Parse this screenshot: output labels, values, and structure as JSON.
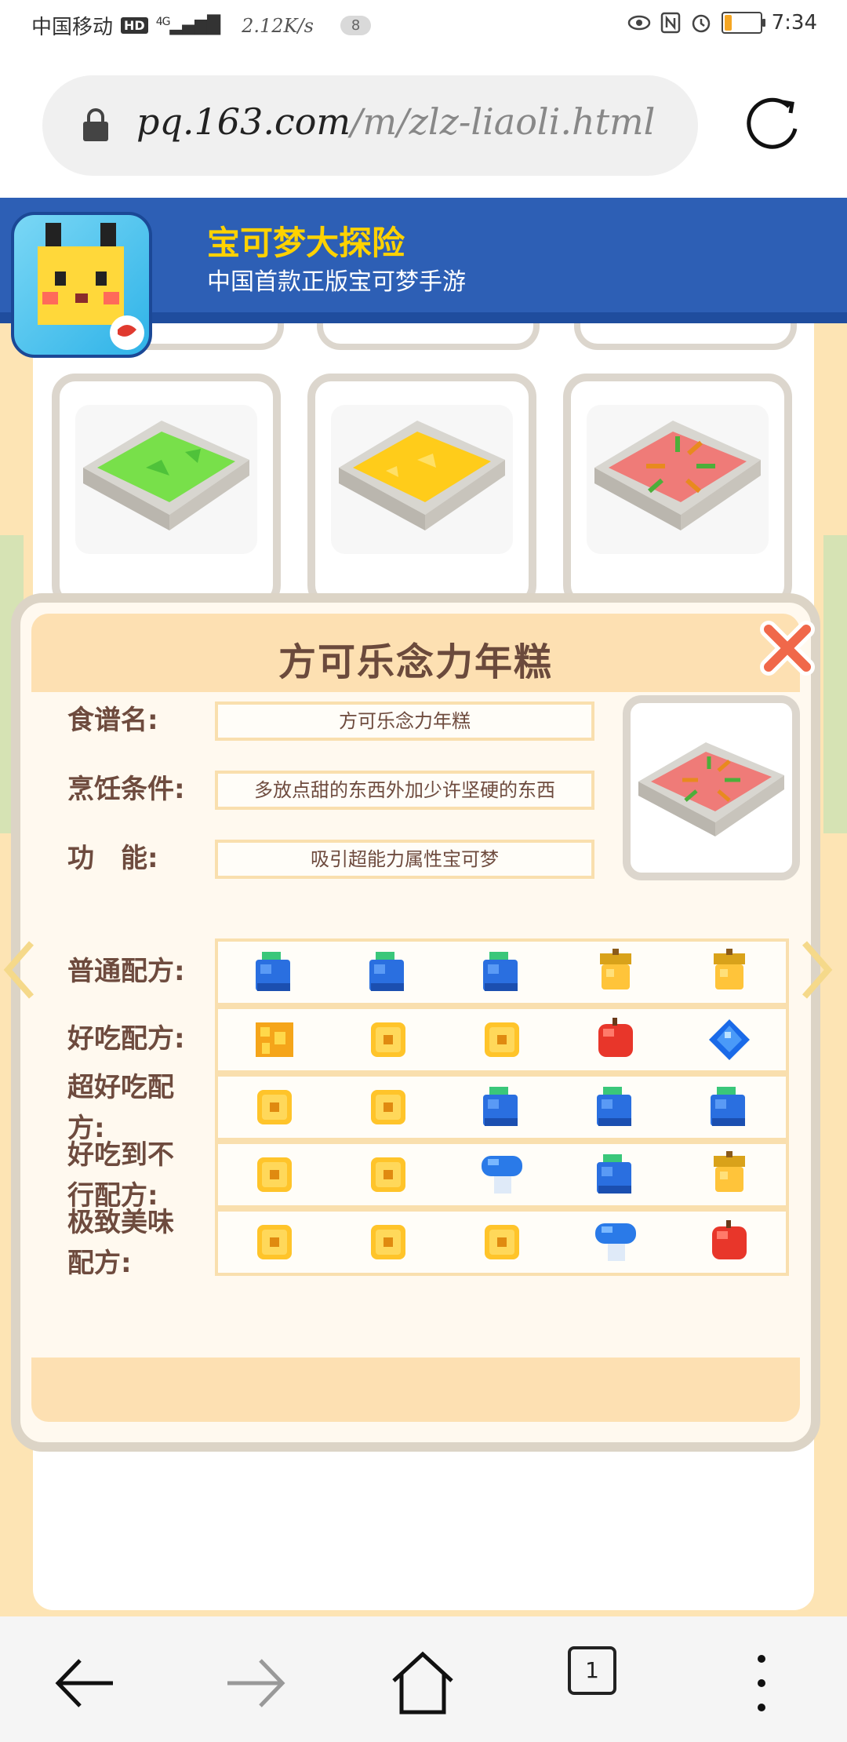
{
  "status_bar": {
    "carrier": "中国移动",
    "hd_badge": "HD",
    "signal": "4G",
    "speed": "2.12K/s",
    "notification_count": "8",
    "battery_level": 0.2,
    "time": "7:34"
  },
  "browser": {
    "url_host": "pq.163.com",
    "url_path": "/m/zlz-liaoli.html",
    "tab_count": "1"
  },
  "site": {
    "title": "宝可梦大探险",
    "subtitle": "中国首款正版宝可梦手游"
  },
  "recipe_cards": [
    {
      "color": "#78e04a",
      "name": "green-soup"
    },
    {
      "color": "#ffcc1a",
      "name": "yellow-soup"
    },
    {
      "color": "#ef7b78",
      "name": "red-soup"
    }
  ],
  "modal": {
    "title": "方可乐念力年糕",
    "fields": [
      {
        "label": "食谱名:",
        "value": "方可乐念力年糕"
      },
      {
        "label": "烹饪条件:",
        "value": "多放点甜的东西外加少许坚硬的东西"
      },
      {
        "label": "功　能:",
        "value": "吸引超能力属性宝可梦"
      }
    ],
    "formulas": [
      {
        "label_line1": "普通配方:",
        "label_line2": "",
        "ingredients": [
          "blue-berry-icon",
          "blue-berry-icon",
          "blue-berry-icon",
          "golden-acorn-icon",
          "golden-acorn-icon"
        ]
      },
      {
        "label_line1": "好吃配方:",
        "label_line2": "",
        "ingredients": [
          "honey-icon",
          "yellow-cube-icon",
          "yellow-cube-icon",
          "red-apple-icon",
          "blue-crystal-icon"
        ]
      },
      {
        "label_line1": "超好吃配",
        "label_line2": "方:",
        "ingredients": [
          "yellow-cube-icon",
          "yellow-cube-icon",
          "blue-berry-icon",
          "blue-berry-icon",
          "blue-berry-icon"
        ]
      },
      {
        "label_line1": "好吃到不",
        "label_line2": "行配方:",
        "ingredients": [
          "yellow-cube-icon",
          "yellow-cube-icon",
          "blue-mushroom-icon",
          "blue-berry-icon",
          "golden-acorn-icon"
        ]
      },
      {
        "label_line1": "极致美味",
        "label_line2": "配方:",
        "ingredients": [
          "yellow-cube-icon",
          "yellow-cube-icon",
          "yellow-cube-icon",
          "blue-mushroom-icon",
          "red-apple-icon"
        ]
      }
    ]
  },
  "colors": {
    "header_blue": "#2d5fb5",
    "title_yellow": "#ffd200",
    "modal_title_bg": "#fde0b2",
    "label_brown": "#6e4b3e"
  }
}
